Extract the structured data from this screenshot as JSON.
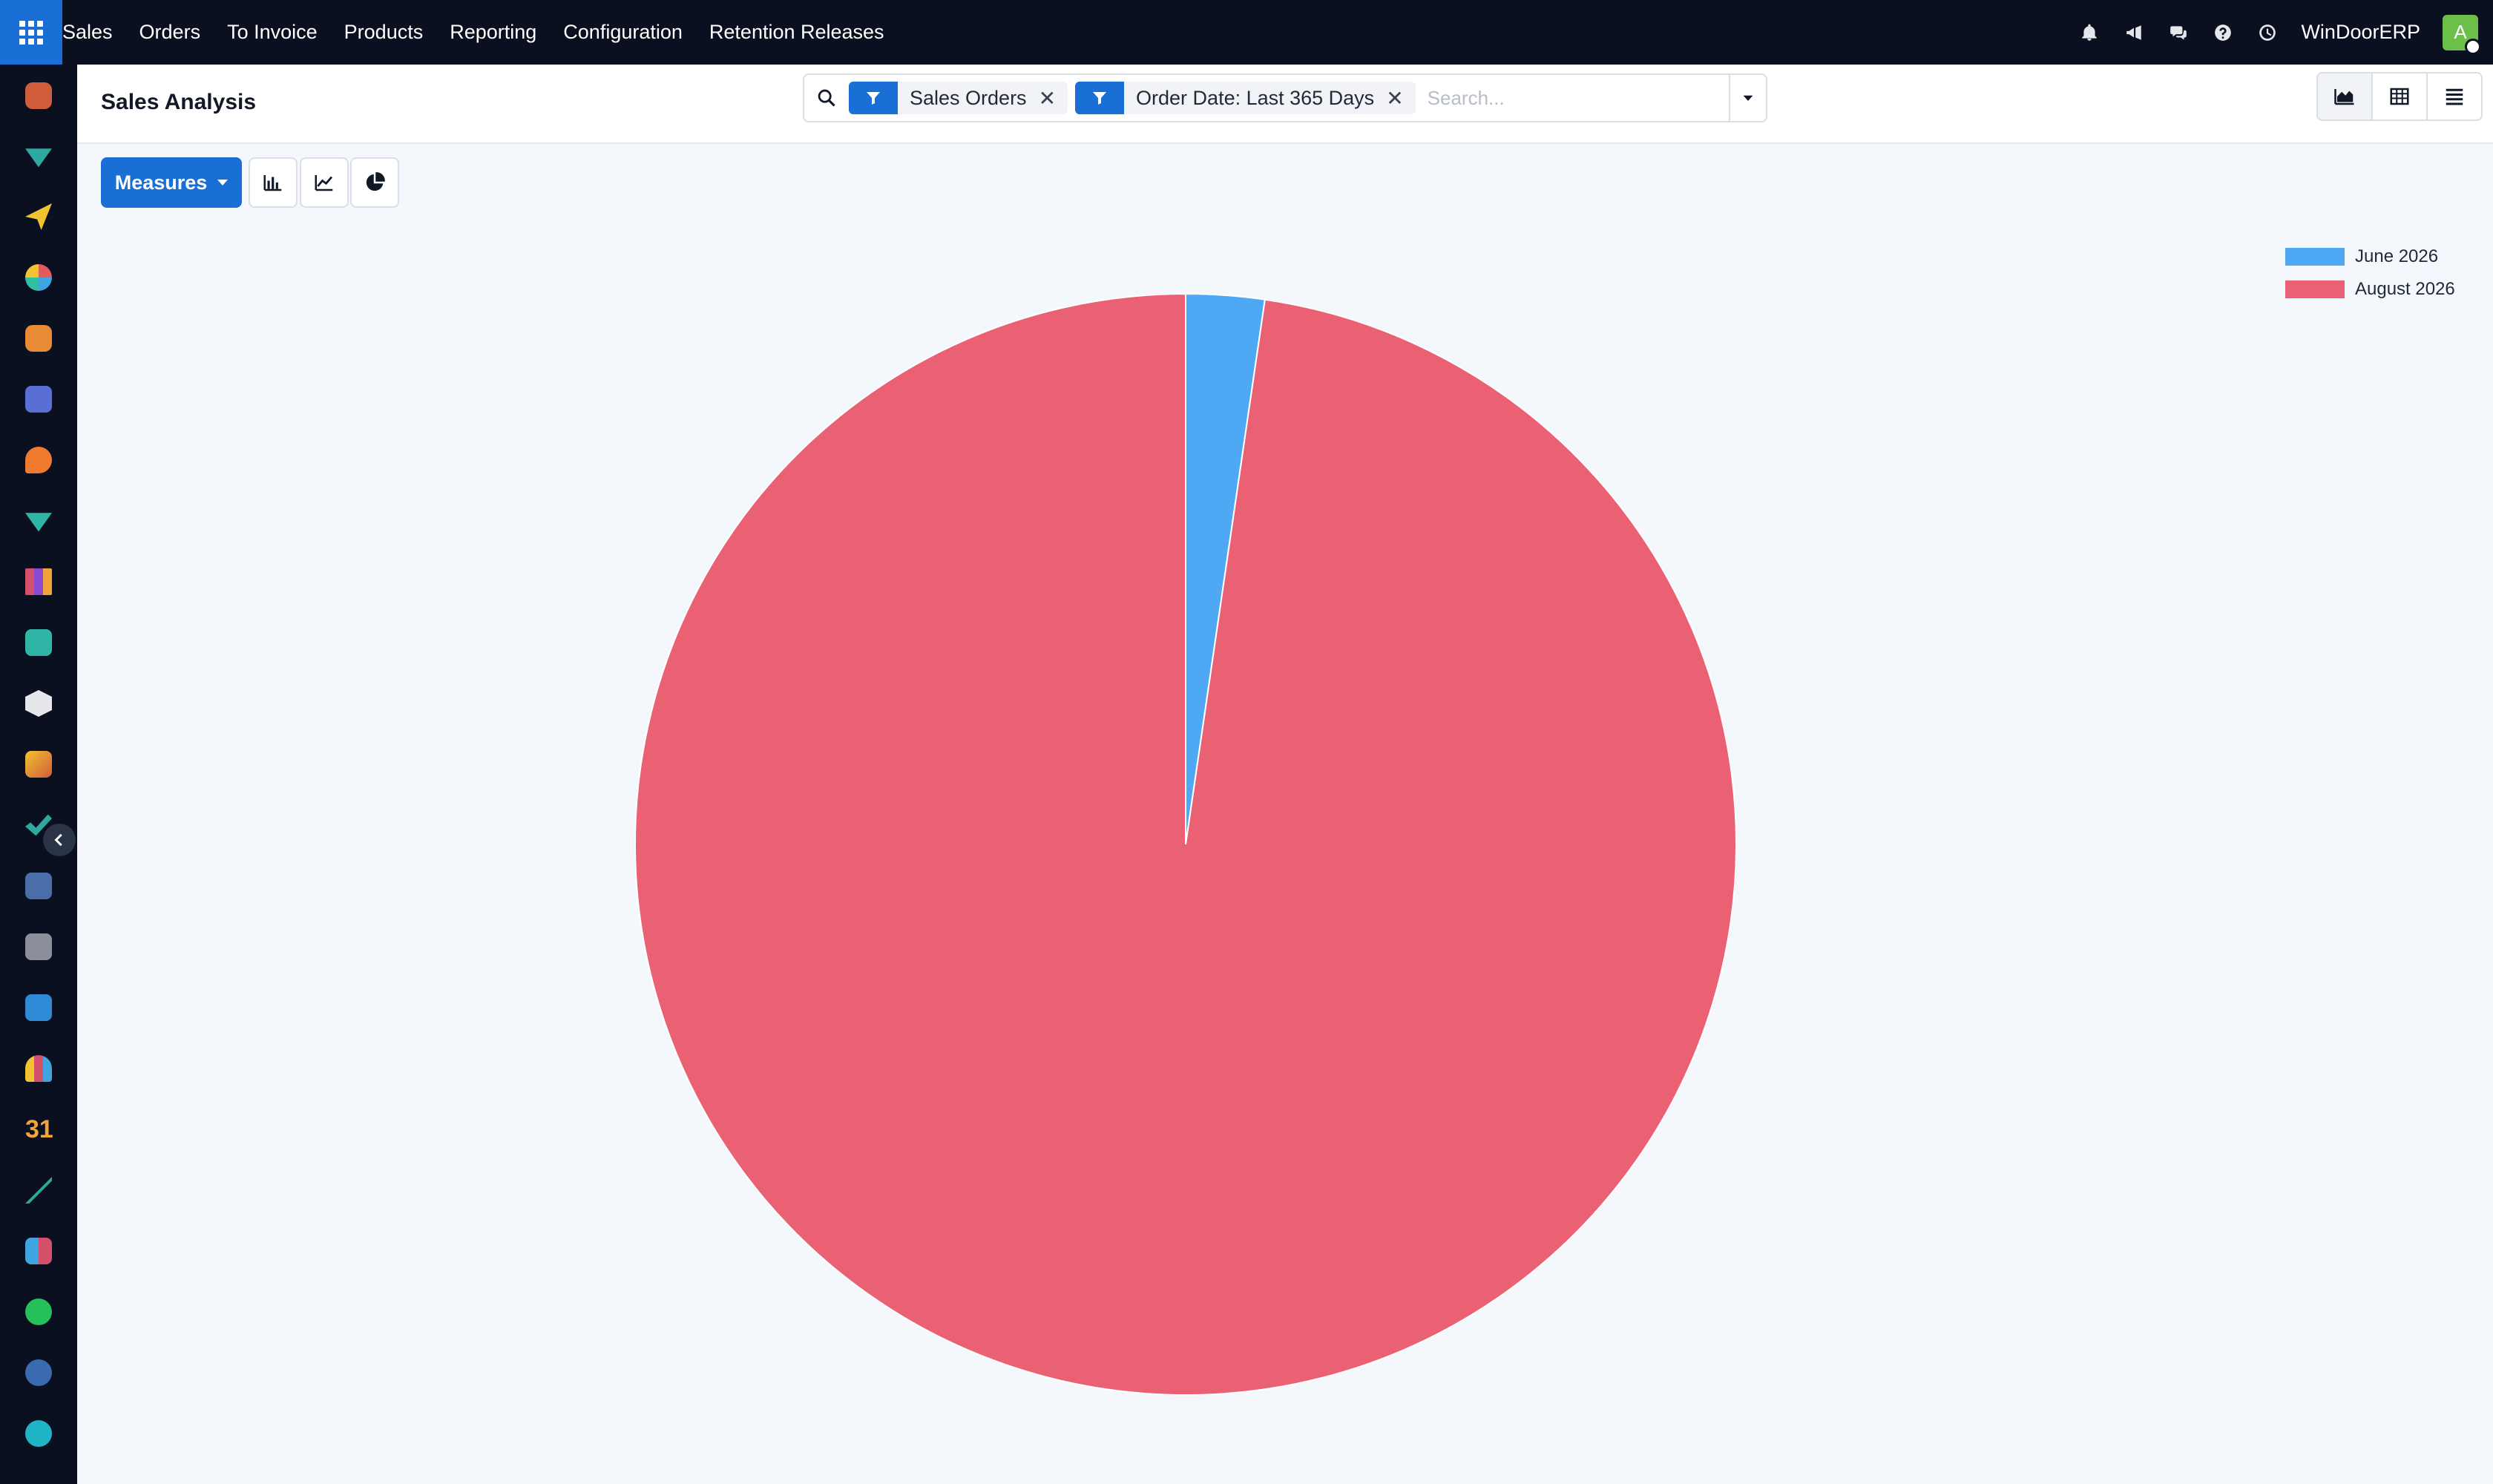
{
  "navbar": {
    "menu": [
      "Sales",
      "Orders",
      "To Invoice",
      "Products",
      "Reporting",
      "Configuration",
      "Retention Releases"
    ],
    "company": "WinDoorERP",
    "avatar_initial": "A"
  },
  "control_panel": {
    "title": "Sales Analysis",
    "facets": [
      {
        "label": "Sales Orders"
      },
      {
        "label": "Order Date: Last 365 Days"
      }
    ],
    "search_placeholder": "Search..."
  },
  "toolbar": {
    "measures_label": "Measures"
  },
  "colors": {
    "accent": "#1a6fd6",
    "series_june": "#4fa8f4",
    "series_august": "#eb6174"
  },
  "chart_data": {
    "type": "pie",
    "labels": [
      "June 2026",
      "August 2026"
    ],
    "values": [
      2.3,
      97.7
    ],
    "colors": [
      "#4fa8f4",
      "#eb6174"
    ],
    "legend_position": "top-right"
  }
}
